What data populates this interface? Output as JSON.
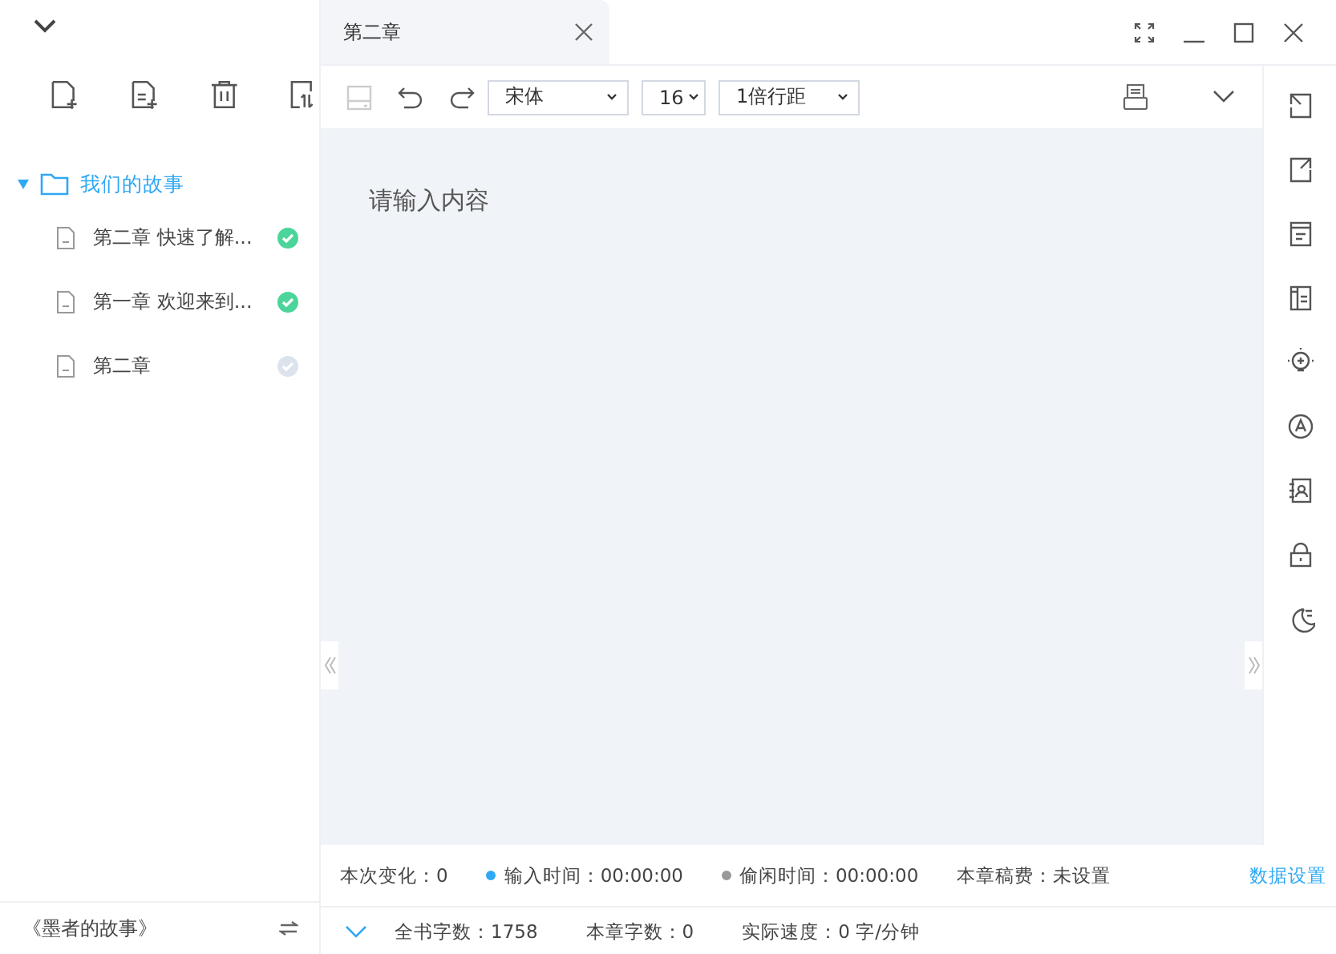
{
  "sidebar": {
    "folder": {
      "name": "我们的故事",
      "expanded": true,
      "selected": true,
      "children": [
        {
          "name": "第二章 快速了解...",
          "done": true
        },
        {
          "name": "第一章 欢迎来到...",
          "done": true
        },
        {
          "name": "第二章",
          "done": false
        }
      ]
    },
    "book_title": "《墨者的故事》"
  },
  "tabs": [
    {
      "label": "第二章",
      "selected": true
    }
  ],
  "toolbar": {
    "font": "宋体",
    "size": "16",
    "line_spacing": "1倍行距"
  },
  "editor": {
    "placeholder": "请输入内容"
  },
  "status_bar": {
    "row_1": [
      {
        "kind": "plain",
        "text": "本次变化：0"
      },
      {
        "kind": "dot",
        "text": "输入时间：00:00:00",
        "color": "#2fa8f5"
      },
      {
        "kind": "dot",
        "text": "偷闲时间：00:00:00",
        "color": "#999999"
      },
      {
        "kind": "plain",
        "text": "本章稿费：未设置"
      },
      {
        "kind": "link",
        "text": "数据设置"
      }
    ],
    "row_2": [
      "全书字数：1758",
      "本章字数：0",
      "实际速度：0 字/分钟"
    ]
  }
}
